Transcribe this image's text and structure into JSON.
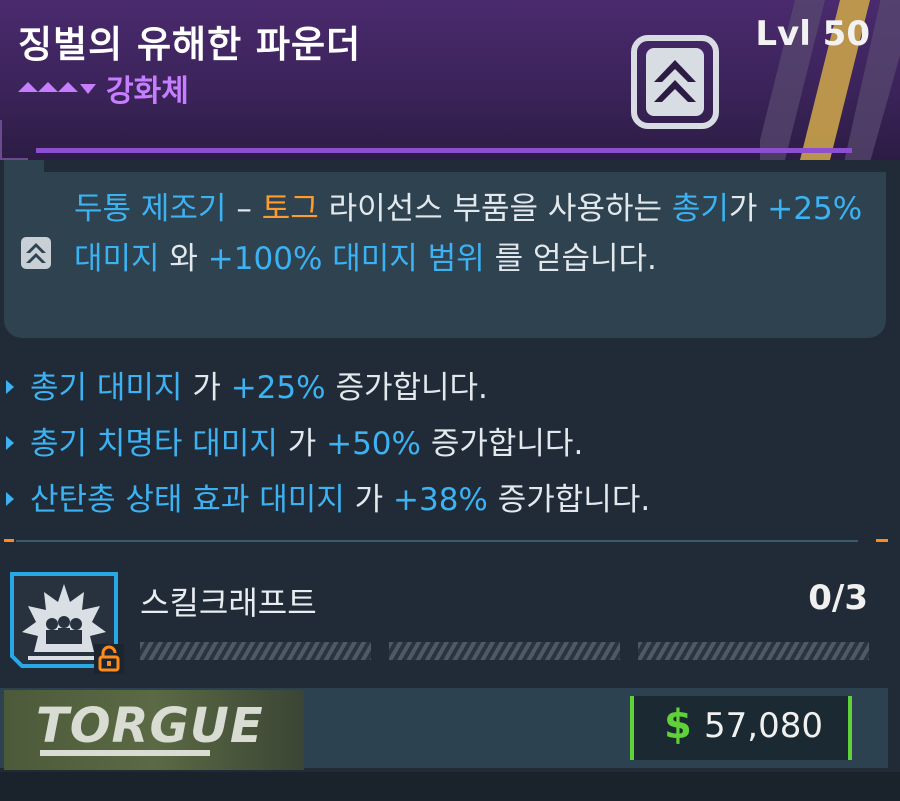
{
  "header": {
    "title": "징벌의 유해한 파운더",
    "rarity": "강화체",
    "level": "Lvl 50",
    "accent_color": "#8b4fd0",
    "rarity_color": "#c77dff"
  },
  "description": {
    "segments": [
      {
        "text": "두통 제조기",
        "style": "blue"
      },
      {
        "text": " – ",
        "style": "plain"
      },
      {
        "text": "토그",
        "style": "orange"
      },
      {
        "text": " 라이선스 부품을 사용하는 ",
        "style": "plain"
      },
      {
        "text": "총기",
        "style": "blue"
      },
      {
        "text": "가 ",
        "style": "plain"
      },
      {
        "text": "+25% 대미지",
        "style": "blue"
      },
      {
        "text": " 와 ",
        "style": "plain"
      },
      {
        "text": "+100% 대미지 범위",
        "style": "blue"
      },
      {
        "text": " 를 얻습니다.",
        "style": "plain"
      }
    ],
    "icon": "chevron-emblem-icon"
  },
  "stats": [
    {
      "name": "총기 대미지",
      "joiner": " 가 ",
      "value": "+25%",
      "suffix": " 증가합니다."
    },
    {
      "name": "총기 치명타 대미지",
      "joiner": " 가 ",
      "value": "+50%",
      "suffix": " 증가합니다."
    },
    {
      "name": "산탄총 상태 효과 대미지",
      "joiner": " 가 ",
      "value": "+38%",
      "suffix": " 증가합니다."
    }
  ],
  "skillcraft": {
    "label": "스킬크래프트",
    "count": "0/3",
    "slots": 3,
    "icon": "skillcraft-crown-icon",
    "lock_icon": "lock-icon"
  },
  "footer": {
    "brand": "TORGUE",
    "currency_symbol": "$",
    "price": "57,080",
    "price_color": "#5fd23a"
  }
}
